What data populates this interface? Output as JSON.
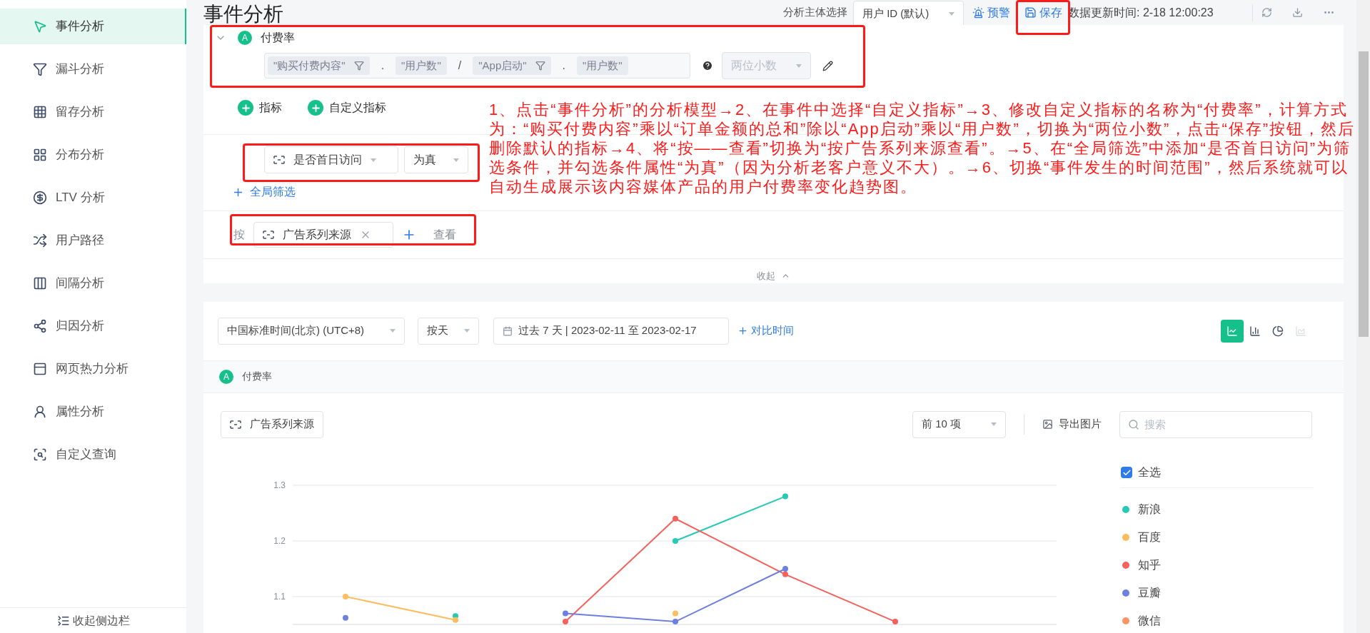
{
  "sidebar": {
    "items": [
      {
        "label": "事件分析",
        "selected": true
      },
      {
        "label": "漏斗分析",
        "selected": false
      },
      {
        "label": "留存分析",
        "selected": false
      },
      {
        "label": "分布分析",
        "selected": false
      },
      {
        "label": "LTV 分析",
        "selected": false
      },
      {
        "label": "用户路径",
        "selected": false
      },
      {
        "label": "间隔分析",
        "selected": false
      },
      {
        "label": "归因分析",
        "selected": false
      },
      {
        "label": "网页热力分析",
        "selected": false
      },
      {
        "label": "属性分析",
        "selected": false
      },
      {
        "label": "自定义查询",
        "selected": false
      }
    ],
    "collapse_label": "收起侧边栏"
  },
  "header": {
    "title": "事件分析",
    "subject_label": "分析主体选择",
    "subject_value": "用户 ID (默认)",
    "alert": "预警",
    "save": "保存",
    "update_time": "数据更新时间: 2-18 12:00:23"
  },
  "metric": {
    "badge": "A",
    "name": "付费率",
    "formula": [
      {
        "kind": "term",
        "text": "\"购买付费内容\"",
        "filter": true
      },
      {
        "kind": "op",
        "text": "."
      },
      {
        "kind": "term",
        "text": "\"用户数\"",
        "filter": false
      },
      {
        "kind": "op",
        "text": "/"
      },
      {
        "kind": "term",
        "text": "\"App启动\"",
        "filter": true
      },
      {
        "kind": "op",
        "text": "."
      },
      {
        "kind": "term",
        "text": "\"用户数\"",
        "filter": false
      }
    ],
    "precision": "两位小数"
  },
  "add_buttons": [
    "指标",
    "自定义指标"
  ],
  "filter": {
    "property": "是否首日访问",
    "value": "为真",
    "add_label": "全局筛选"
  },
  "group_by": {
    "prefix": "按",
    "property": "广告系列来源",
    "suffix": "查看"
  },
  "collapse_label": "收起",
  "annotation": "1、点击“事件分析”的分析模型→2、在事件中选择“自定义指标”→3、修改自定义指标的名称为“付费率”，计算方式为：“购买付费内容”乘以“订单金额的总和”除以“App启动”乘以“用户数”，切换为“两位小数”，点击“保存”按钮，然后删除默认的指标→4、将“按——查看”切换为“按广告系列来源查看”。→5、在“全局筛选”中添加“是否首日访问”为筛选条件，并勾选条件属性“为真”（因为分析老客户意义不大）。→6、切换“事件发生的时间范围”，然后系统就可以自动生成展示该内容媒体产品的用户付费率变化趋势图。",
  "toolbar": {
    "timezone": "中国标准时间(北京) (UTC+8)",
    "granularity": "按天",
    "date_range": "过去 7 天 | 2023-02-11 至 2023-02-17",
    "compare": "对比时间",
    "chart_types": [
      {
        "kind": "line",
        "selected": true,
        "disabled": false
      },
      {
        "kind": "bar",
        "selected": false,
        "disabled": false
      },
      {
        "kind": "pie",
        "selected": false,
        "disabled": false
      },
      {
        "kind": "area",
        "selected": false,
        "disabled": true
      }
    ]
  },
  "metric_legend": {
    "badge": "A",
    "name": "付费率"
  },
  "result": {
    "group_chip": "广告系列来源",
    "top_n": "前 10 项",
    "export": "导出图片",
    "search_placeholder": "搜索",
    "select_all": {
      "label": "全选",
      "checked": true
    },
    "chart_data": {
      "type": "line",
      "ylim": [
        1.05,
        1.3
      ],
      "yticks": [
        1.1,
        1.2,
        1.3
      ],
      "series": [
        {
          "name": "新浪",
          "color": "#26c9b3",
          "marker": "circle",
          "values": [
            null,
            1.065,
            null,
            1.2,
            1.28,
            null,
            null
          ]
        },
        {
          "name": "百度",
          "color": "#fbbd5f",
          "marker": "circle",
          "values": [
            1.1,
            1.058,
            null,
            1.07,
            null,
            null,
            null
          ]
        },
        {
          "name": "知乎",
          "color": "#f5615d",
          "marker": "circle",
          "values": [
            null,
            null,
            1.055,
            1.24,
            1.14,
            1.055,
            null
          ]
        },
        {
          "name": "豆瓣",
          "color": "#6d7fe0",
          "marker": "circle",
          "values": [
            1.062,
            null,
            1.07,
            1.055,
            1.15,
            null,
            null
          ]
        },
        {
          "name": "微信",
          "color": "#fb9466",
          "values": [
            null,
            null,
            null,
            null,
            null,
            null,
            null
          ]
        }
      ]
    }
  }
}
